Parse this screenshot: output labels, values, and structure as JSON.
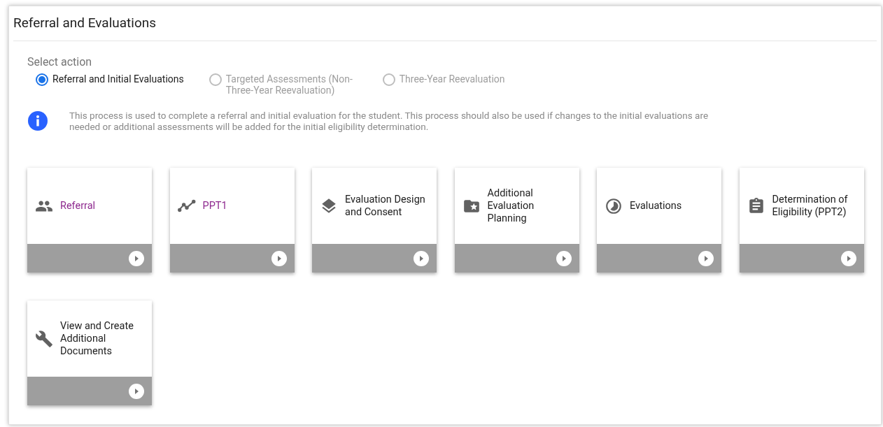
{
  "panel": {
    "title": "Referral and Evaluations"
  },
  "action_group": {
    "label": "Select action",
    "options": [
      {
        "label": "Referral and Initial Evaluations",
        "selected": true
      },
      {
        "label": "Targeted Assessments (Non-Three-Year Reevaluation)",
        "selected": false
      },
      {
        "label": "Three-Year Reevaluation",
        "selected": false
      }
    ]
  },
  "info": {
    "text": "This process is used to complete a referral and initial evaluation for the student. This process should also be used if changes to the initial evaluations are needed or additional assessments will be added for the initial eligibility determination."
  },
  "cards": [
    {
      "label": "Referral",
      "visited": true
    },
    {
      "label": "PPT1",
      "visited": true
    },
    {
      "label": "Evaluation Design and Consent",
      "visited": false
    },
    {
      "label": "Additional Evaluation Planning",
      "visited": false
    },
    {
      "label": "Evaluations",
      "visited": false
    },
    {
      "label": "Determination of Eligibility (PPT2)",
      "visited": false
    },
    {
      "label": "View and Create Additional Documents",
      "visited": false
    }
  ]
}
